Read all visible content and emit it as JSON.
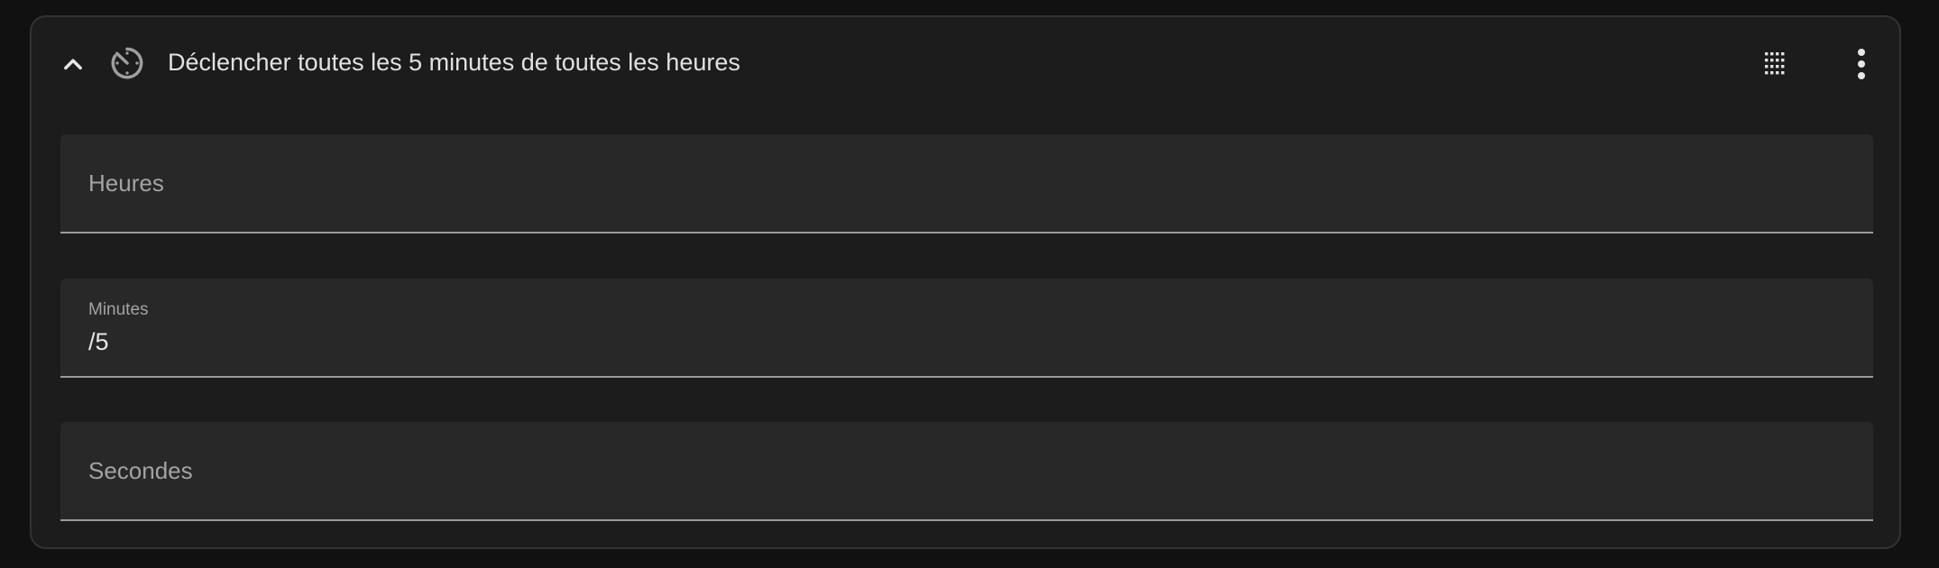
{
  "trigger": {
    "title": "Déclencher toutes les 5 minutes de toutes les heures",
    "icons": {
      "collapse": "chevron-up-icon",
      "trigger_type": "timer-clock-icon",
      "drag": "drag-handle-icon",
      "menu": "dots-vertical-icon"
    },
    "fields": {
      "hours": {
        "label": "Heures",
        "value": ""
      },
      "minutes": {
        "label": "Minutes",
        "value": "/5"
      },
      "seconds": {
        "label": "Secondes",
        "value": ""
      }
    }
  },
  "colors": {
    "page_background": "#111111",
    "card_background": "#1c1c1c",
    "card_border": "#333333",
    "field_background": "#282828",
    "field_underline": "#9a9a9a",
    "label_text": "#a3a3a3",
    "primary_text": "#e1e1e1",
    "icon": "#e0e0e0"
  }
}
